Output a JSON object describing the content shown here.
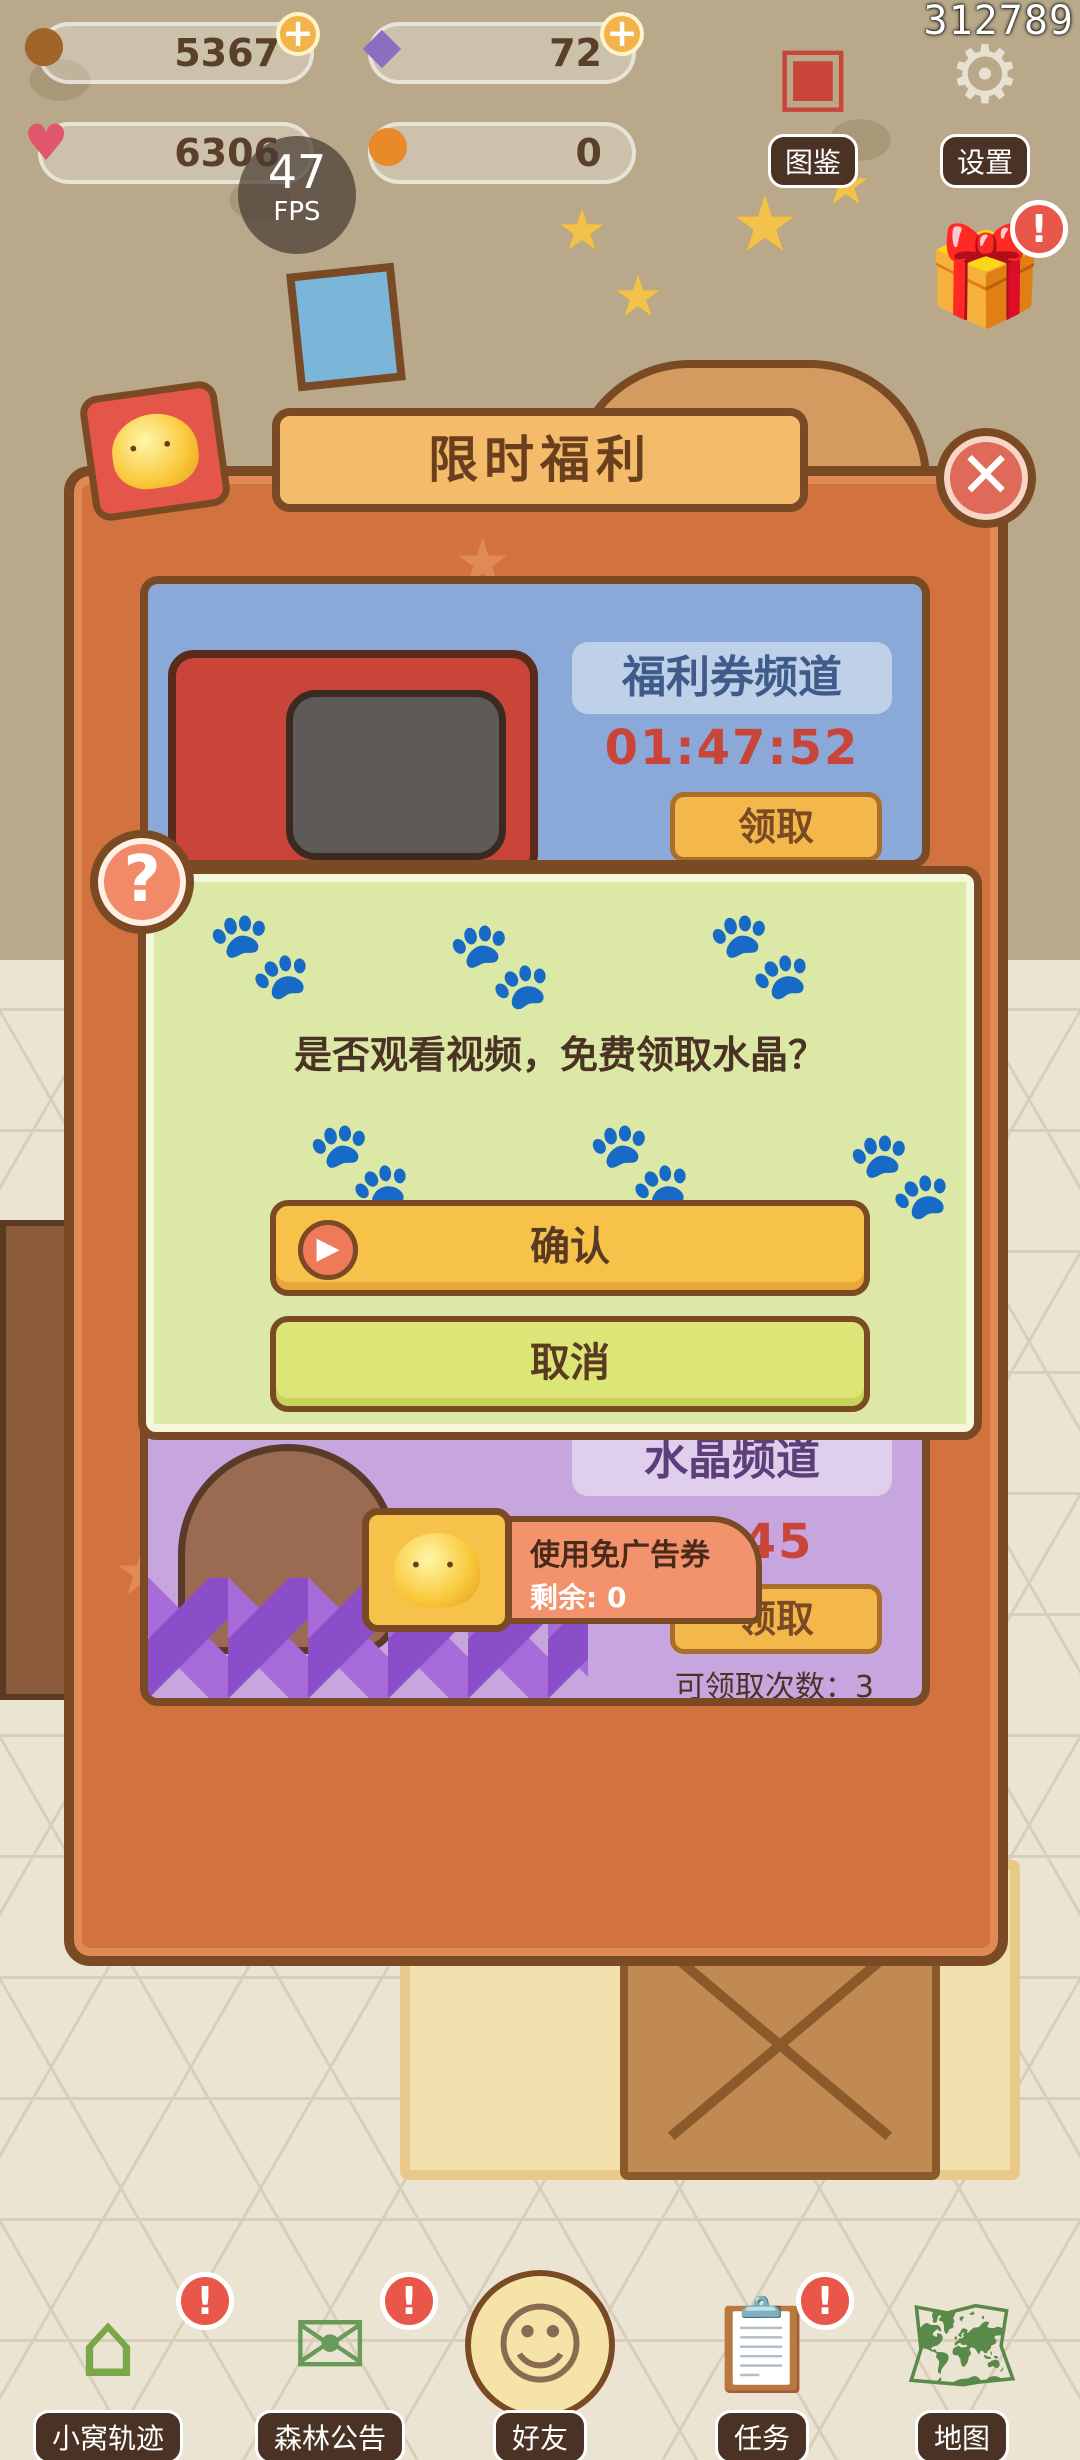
{
  "hud": {
    "acorn": "5367",
    "crystal": "72",
    "heart": "6306",
    "pumpkin": "0",
    "fps_value": "47",
    "fps_label": "FPS",
    "corner_id": "312789"
  },
  "top_buttons": {
    "album": "图鉴",
    "settings": "设置"
  },
  "panel": {
    "title": "限时福利",
    "channels": [
      {
        "name": "福利券频道",
        "timer": "01:47:52",
        "claim": "领取"
      },
      {
        "name": "水晶频道",
        "timer": "13:45",
        "claim": "领取",
        "times": "可领取次数：3"
      }
    ],
    "ad_ticket": {
      "label": "使用免广告券",
      "remaining": "剩余: 0"
    }
  },
  "dialog": {
    "message": "是否观看视频，免费领取水晶？",
    "confirm": "确认",
    "cancel": "取消"
  },
  "bottom_nav": [
    {
      "label": "小窝轨迹"
    },
    {
      "label": "森林公告"
    },
    {
      "label": "好友"
    },
    {
      "label": "任务"
    },
    {
      "label": "地图"
    }
  ],
  "colors": {
    "panel": "#d2733f",
    "outline": "#7a4a24",
    "dialog": "#dce8a6",
    "confirm": "#f6c24a",
    "cancel": "#dbe676",
    "alert": "#e9574a"
  }
}
